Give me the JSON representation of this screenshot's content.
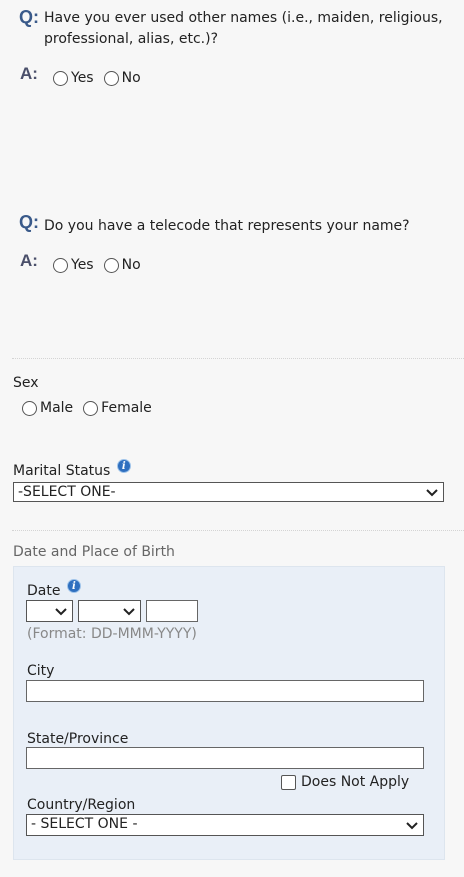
{
  "q1": {
    "q_mark": "Q:",
    "question_line1": "Have you ever used other names (i.e., maiden, religious,",
    "question_line2": "professional, alias, etc.)?",
    "a_mark": "A:",
    "options": [
      "Yes",
      "No"
    ]
  },
  "q2": {
    "q_mark": "Q:",
    "question": "Do you have a telecode that represents your name?",
    "a_mark": "A:",
    "options": [
      "Yes",
      "No"
    ]
  },
  "sex": {
    "label": "Sex",
    "options": [
      "Male",
      "Female"
    ]
  },
  "marital": {
    "label": "Marital Status",
    "selected": "-SELECT ONE-"
  },
  "birth": {
    "section_title": "Date and Place of Birth",
    "date_label": "Date",
    "date_format_hint": "(Format: DD-MMM-YYYY)",
    "city_label": "City",
    "state_label": "State/Province",
    "does_not_apply": "Does Not Apply",
    "country_label": "Country/Region",
    "country_selected": "- SELECT ONE -"
  },
  "icons": {
    "info": "info-icon",
    "dropdown": "chevron-down-icon"
  },
  "colors": {
    "qa_mark": "#3a5a8a",
    "panel_bg": "#e9eff7",
    "info_icon": "#2f6fbf"
  }
}
